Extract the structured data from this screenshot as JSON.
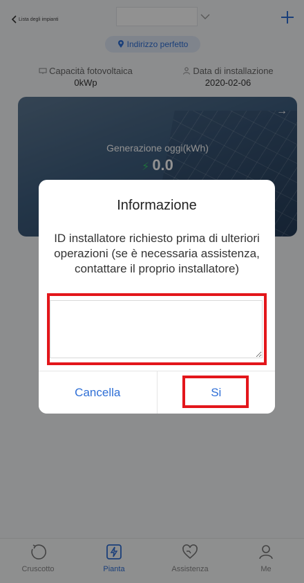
{
  "header": {
    "back_label": "Lista degli impianti",
    "plant_name": "",
    "accent": "#2f6fd6"
  },
  "address": {
    "label": "Indirizzo perfetto"
  },
  "stats": {
    "capacity_label": "Capacità fotovoltaica",
    "capacity_value": "0kWp",
    "install_label": "Data di installazione",
    "install_value": "2020-02-06"
  },
  "banner": {
    "generation_label": "Generazione oggi(kWh)",
    "generation_value": "0.0"
  },
  "tabs": [
    {
      "label": "Cruscotto",
      "icon": "gauge-icon",
      "active": false
    },
    {
      "label": "Pianta",
      "icon": "plant-icon",
      "active": true
    },
    {
      "label": "Assistenza",
      "icon": "heart-icon",
      "active": false
    },
    {
      "label": "Me",
      "icon": "person-icon",
      "active": false
    }
  ],
  "dialog": {
    "title": "Informazione",
    "message": "ID installatore richiesto prima di ulteriori operazioni (se è necessaria assistenza, contattare il proprio installatore)",
    "input_value": "",
    "cancel_label": "Cancella",
    "confirm_label": "Si"
  },
  "colors": {
    "annotation": "#e3161b",
    "overlay": "rgba(0,0,0,0.43)"
  }
}
